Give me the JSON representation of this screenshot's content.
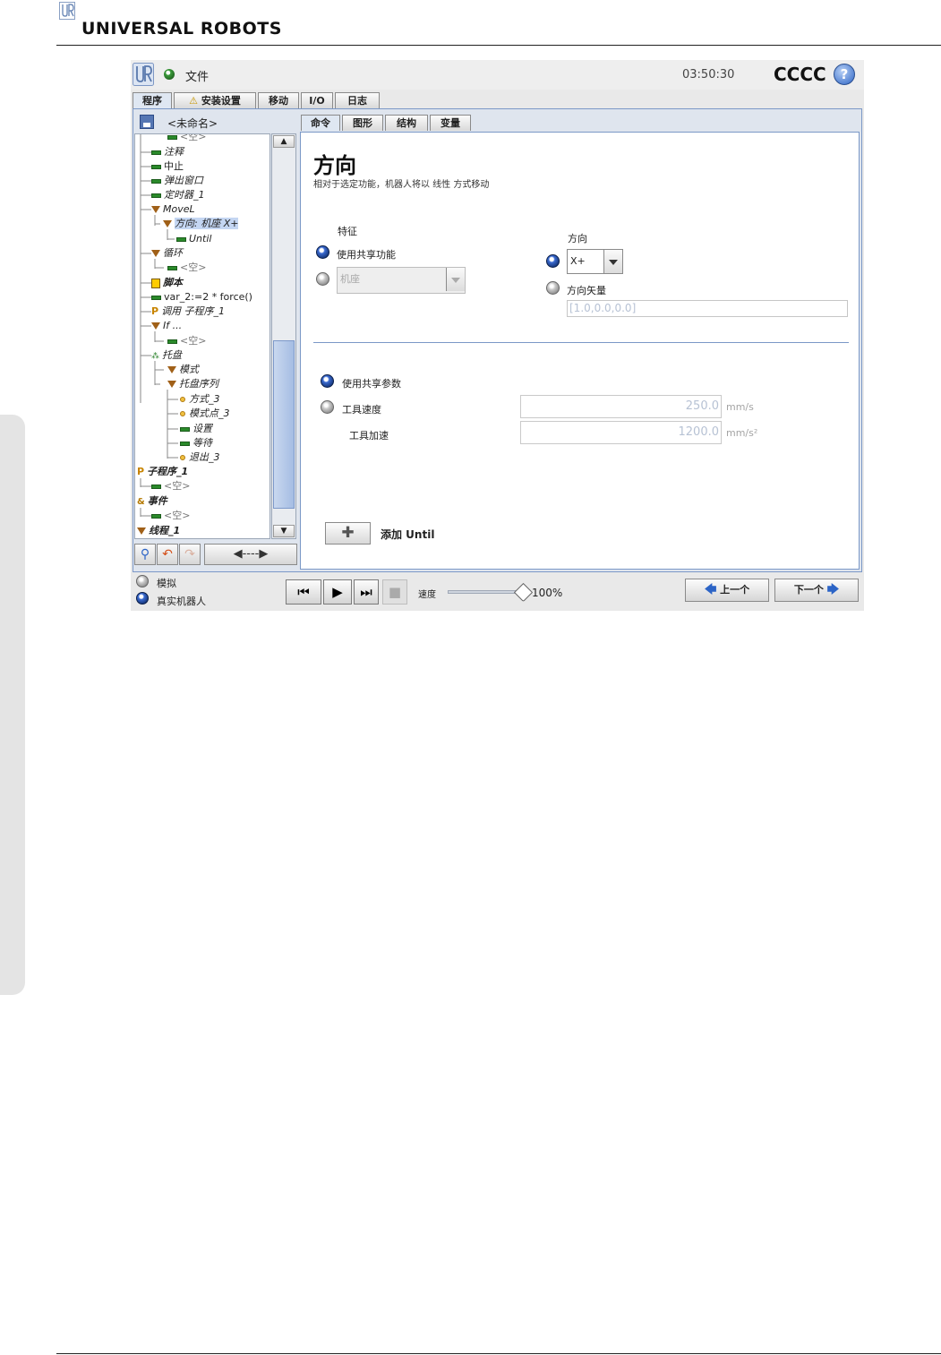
{
  "page": {
    "brand": "UNIVERSAL ROBOTS"
  },
  "titlebar": {
    "file_menu": "文件",
    "clock": "03:50:30",
    "robot_name": "CCCC",
    "help": "?"
  },
  "main_tabs": [
    {
      "label": "程序"
    },
    {
      "label": "安装设置"
    },
    {
      "label": "移动"
    },
    {
      "label": "I/O"
    },
    {
      "label": "日志"
    }
  ],
  "program": {
    "name": "<未命名>"
  },
  "tree": {
    "items": [
      {
        "label": "<空>"
      },
      {
        "label": "注释"
      },
      {
        "label": "中止"
      },
      {
        "label": "弹出窗口"
      },
      {
        "label": "定时器_1"
      },
      {
        "label": "MoveL"
      },
      {
        "label": "方向: 机座 X+"
      },
      {
        "label": "Until"
      },
      {
        "label": "循环"
      },
      {
        "label": "<空>"
      },
      {
        "label": "脚本"
      },
      {
        "label": "var_2:=2 * force()"
      },
      {
        "label": "调用 子程序_1"
      },
      {
        "label": "If ..."
      },
      {
        "label": "<空>"
      },
      {
        "label": "托盘"
      },
      {
        "label": "模式"
      },
      {
        "label": "托盘序列"
      },
      {
        "label": "方式_3"
      },
      {
        "label": "模式点_3"
      },
      {
        "label": "设置"
      },
      {
        "label": "等待"
      },
      {
        "label": "退出_3"
      },
      {
        "label": "子程序_1"
      },
      {
        "label": "<空>"
      },
      {
        "label": "事件"
      },
      {
        "label": "<空>"
      },
      {
        "label": "线程_1"
      }
    ]
  },
  "sub_tabs": [
    {
      "label": "命令"
    },
    {
      "label": "图形"
    },
    {
      "label": "结构"
    },
    {
      "label": "变量"
    }
  ],
  "command": {
    "title": "方向",
    "description": "相对于选定功能，机器人将以 线性 方式移动",
    "feature_label": "特征",
    "use_shared_feature": "使用共享功能",
    "feature_value": "机座",
    "direction_label": "方向",
    "direction_value": "X+",
    "direction_vector_label": "方向矢量",
    "direction_vector_value": "[1.0,0.0,0.0]",
    "use_shared_params": "使用共享参数",
    "tool_speed_label": "工具速度",
    "tool_speed_value": "250.0",
    "tool_speed_unit": "mm/s",
    "tool_accel_label": "工具加速",
    "tool_accel_value": "1200.0",
    "tool_accel_unit": "mm/s²",
    "add_until": "添加 Until"
  },
  "bottom": {
    "simulation": "模拟",
    "real_robot": "真实机器人",
    "speed_label": "速度",
    "speed_value": "100%",
    "speed_fraction": 1.0,
    "prev": "上一个",
    "next": "下一个"
  }
}
